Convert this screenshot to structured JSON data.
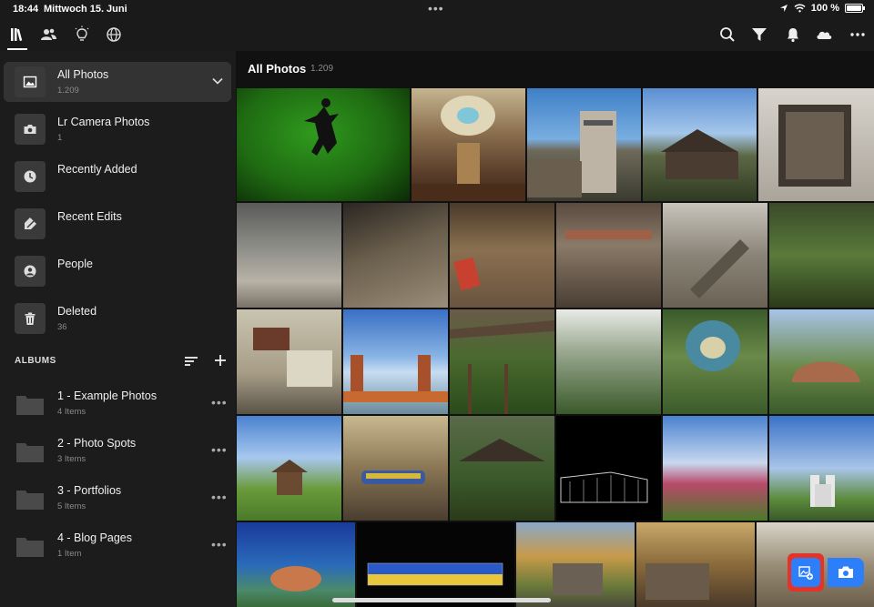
{
  "status_bar": {
    "time": "18:44",
    "date": "Mittwoch 15. Juni",
    "dots": "•••",
    "battery": "100 %"
  },
  "toolbar": {
    "tabs": [
      {
        "icon": "library-icon"
      },
      {
        "icon": "people-icon"
      },
      {
        "icon": "learn-icon"
      },
      {
        "icon": "discover-icon"
      }
    ],
    "actions": [
      {
        "icon": "search-icon"
      },
      {
        "icon": "filter-icon"
      },
      {
        "icon": "bell-icon"
      },
      {
        "icon": "cloud-icon"
      },
      {
        "icon": "more-icon"
      }
    ]
  },
  "sidebar": {
    "items": [
      {
        "label": "All Photos",
        "count": "1.209",
        "icon": "photo-icon"
      },
      {
        "label": "Lr Camera Photos",
        "count": "1",
        "icon": "camera-icon"
      },
      {
        "label": "Recently Added",
        "count": "",
        "icon": "clock-icon"
      },
      {
        "label": "Recent Edits",
        "count": "",
        "icon": "edit-icon"
      },
      {
        "label": "People",
        "count": "",
        "icon": "person-icon"
      },
      {
        "label": "Deleted",
        "count": "36",
        "icon": "trash-icon"
      }
    ],
    "albums_header": "ALBUMS",
    "albums": [
      {
        "label": "1 - Example Photos",
        "count": "4 Items"
      },
      {
        "label": "2 - Photo Spots",
        "count": "3 Items"
      },
      {
        "label": "3 - Portfolios",
        "count": "5 Items"
      },
      {
        "label": "4 - Blog Pages",
        "count": "1 Item"
      }
    ],
    "more_label": "•••"
  },
  "main": {
    "title": "All Photos",
    "count": "1.209"
  },
  "colors": {
    "accent_blue": "#2d7ff9",
    "highlight_red": "#e2342b"
  }
}
